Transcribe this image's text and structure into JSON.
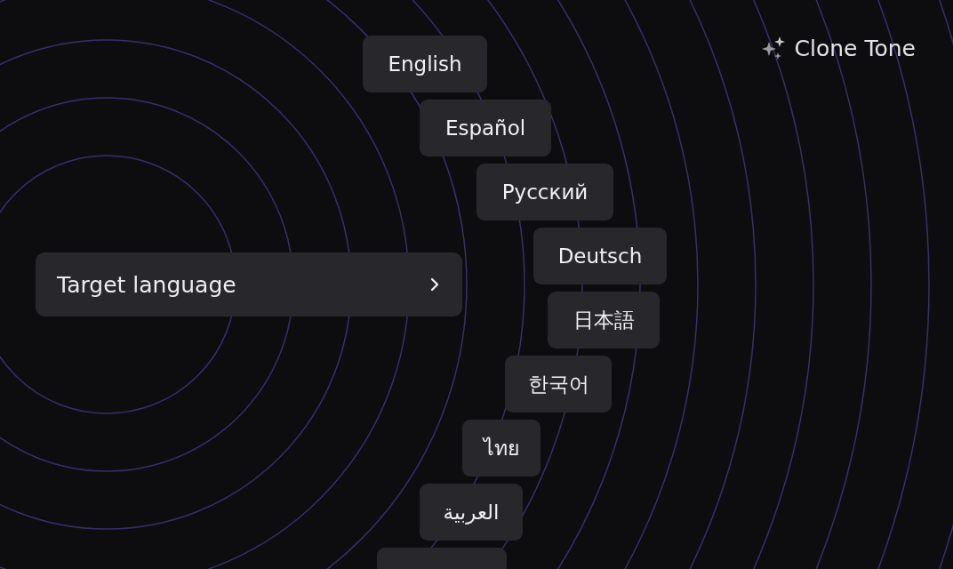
{
  "brand": {
    "label": "Clone Tone"
  },
  "target_language": {
    "label": "Target language"
  },
  "languages": [
    {
      "kind": "chip",
      "label": "English"
    },
    {
      "kind": "chip",
      "label": "Español"
    },
    {
      "kind": "chip",
      "label": "Русский"
    },
    {
      "kind": "chip",
      "label": "Deutsch"
    },
    {
      "kind": "chip",
      "label": "日本語"
    },
    {
      "kind": "chip",
      "label": "한국어"
    },
    {
      "kind": "chip",
      "label": "ไทย"
    },
    {
      "kind": "chip",
      "label": "العربية"
    },
    {
      "kind": "cut"
    }
  ]
}
